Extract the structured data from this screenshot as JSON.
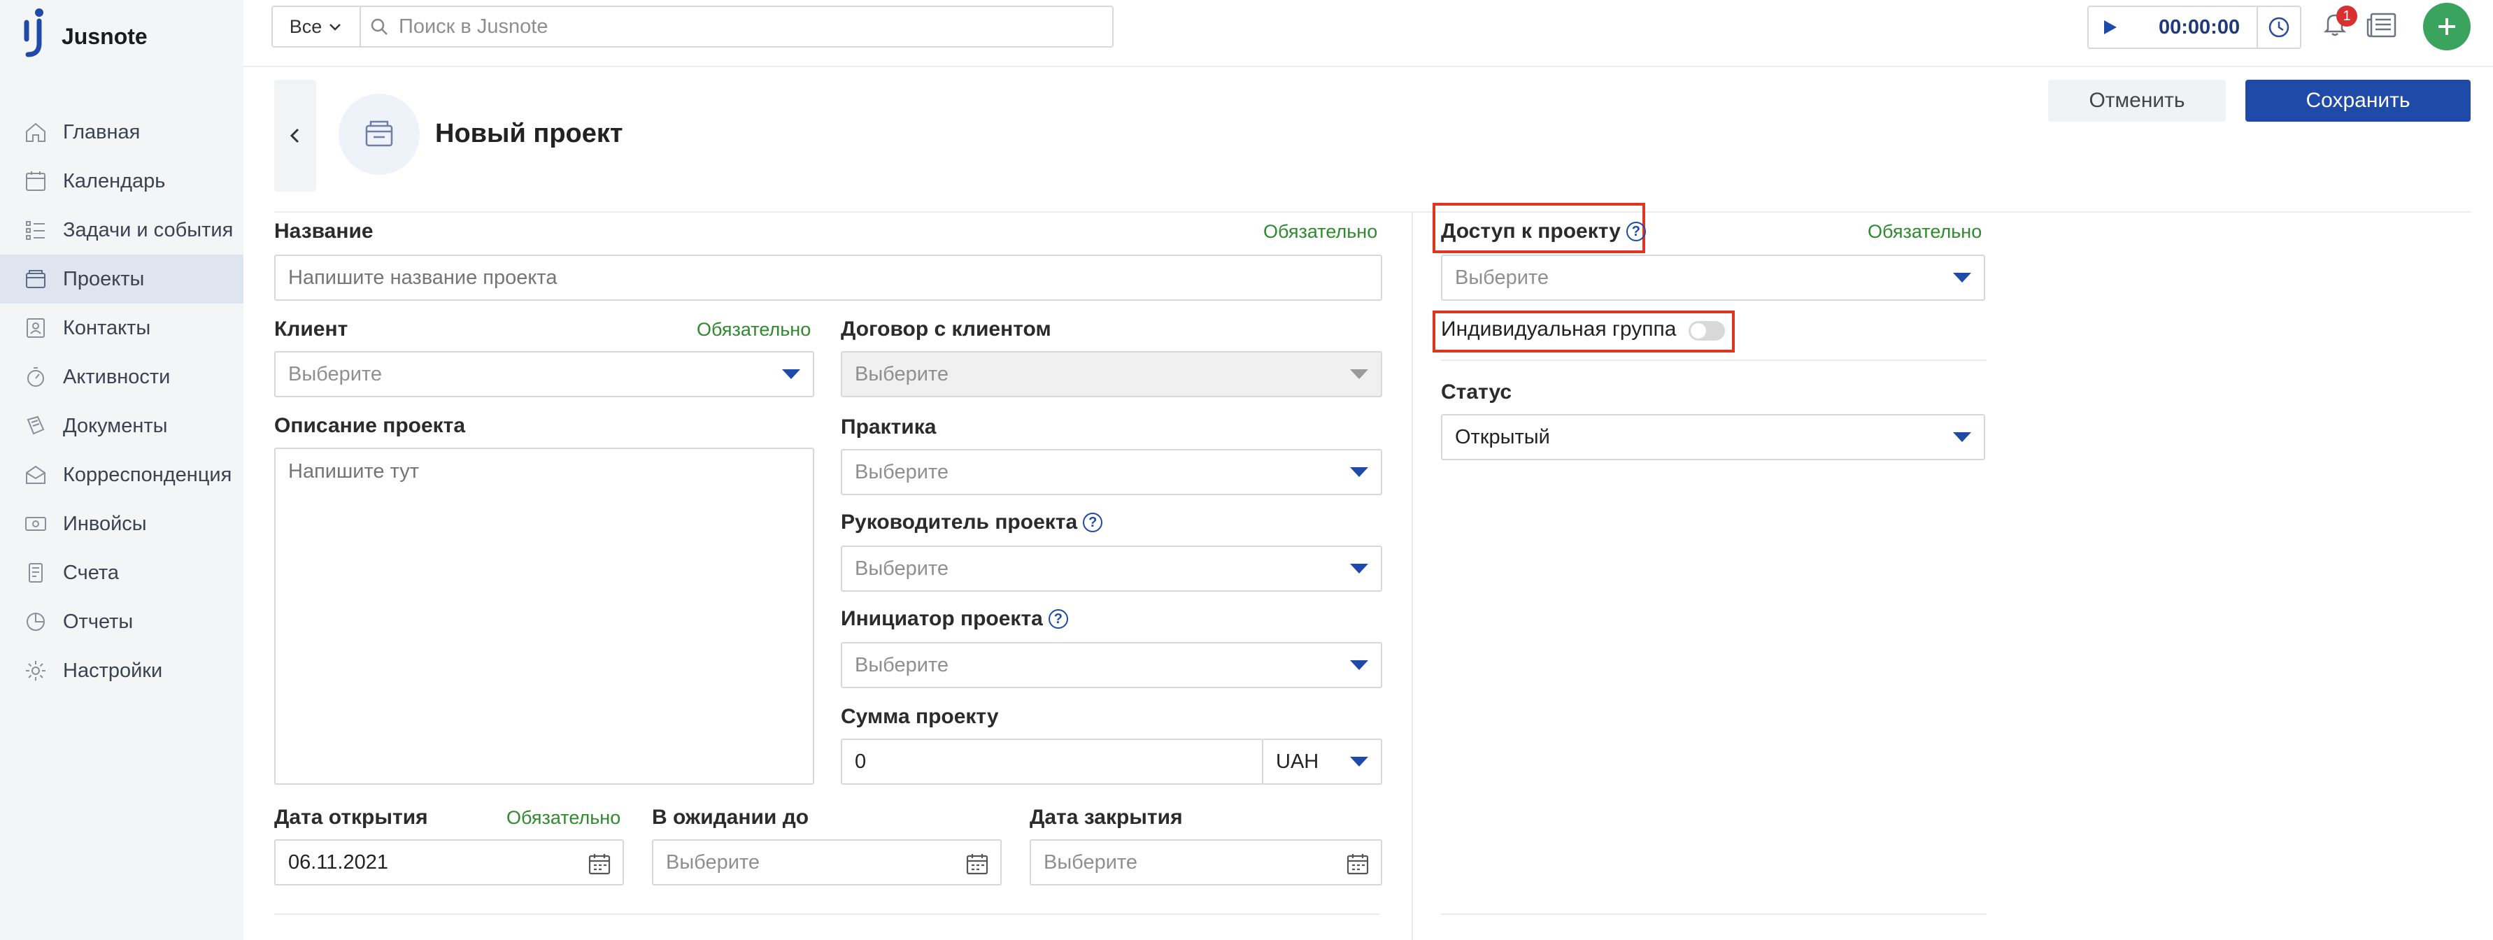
{
  "app": {
    "name": "Jusnote"
  },
  "sidebar": {
    "items": [
      {
        "label": "Главная",
        "icon": "home-icon"
      },
      {
        "label": "Календарь",
        "icon": "calendar-icon"
      },
      {
        "label": "Задачи и события",
        "icon": "tasks-icon"
      },
      {
        "label": "Проекты",
        "icon": "projects-icon",
        "active": true
      },
      {
        "label": "Контакты",
        "icon": "contacts-icon"
      },
      {
        "label": "Активности",
        "icon": "activity-icon"
      },
      {
        "label": "Документы",
        "icon": "documents-icon"
      },
      {
        "label": "Корреспонденция",
        "icon": "mail-icon"
      },
      {
        "label": "Инвойсы",
        "icon": "invoice-icon"
      },
      {
        "label": "Счета",
        "icon": "bills-icon"
      },
      {
        "label": "Отчеты",
        "icon": "reports-icon"
      },
      {
        "label": "Настройки",
        "icon": "gear-icon"
      }
    ]
  },
  "topbar": {
    "scope": "Все",
    "search_placeholder": "Поиск в Jusnote",
    "timer": "00:00:00",
    "notifications_count": "1"
  },
  "header": {
    "title": "Новый проект",
    "cancel": "Отменить",
    "save": "Сохранить"
  },
  "form": {
    "required_label": "Обязательно",
    "name": {
      "label": "Название",
      "placeholder": "Напишите название проекта"
    },
    "client": {
      "label": "Клиент",
      "value": "Выберите"
    },
    "contract": {
      "label": "Договор с клиентом",
      "value": "Выберите"
    },
    "description": {
      "label": "Описание проекта",
      "placeholder": "Напишите тут"
    },
    "practice": {
      "label": "Практика",
      "value": "Выберите"
    },
    "manager": {
      "label": "Руководитель проекта",
      "value": "Выберите"
    },
    "initiator": {
      "label": "Инициатор проекта",
      "value": "Выберите"
    },
    "amount": {
      "label": "Сумма проекту",
      "value": "0",
      "currency": "UAH"
    },
    "open_date": {
      "label": "Дата открытия",
      "value": "06.11.2021"
    },
    "pending_until": {
      "label": "В ожидании до",
      "value": "Выберите"
    },
    "close_date": {
      "label": "Дата закрытия",
      "value": "Выберите"
    },
    "access": {
      "label": "Доступ к проекту",
      "value": "Выберите"
    },
    "individual_group": {
      "label": "Индивидуальная группа",
      "enabled": false
    },
    "status": {
      "label": "Статус",
      "value": "Открытый"
    }
  },
  "colors": {
    "accent": "#1f4aa8",
    "required": "#2f8a2f",
    "highlight": "#e0361f",
    "add": "#3aa35e"
  }
}
